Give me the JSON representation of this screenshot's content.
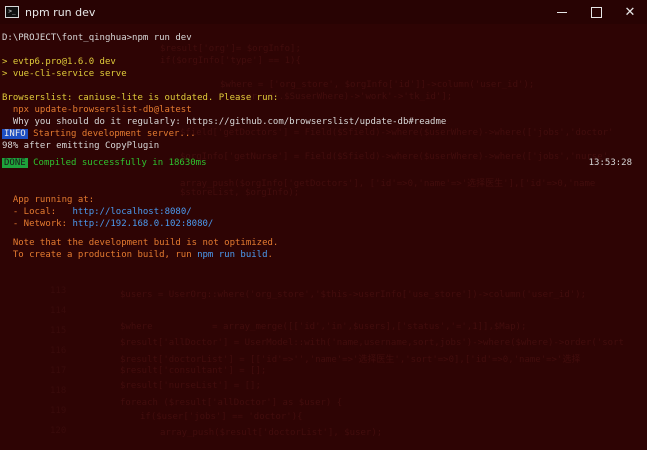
{
  "window": {
    "title": "npm run dev",
    "icon": "terminal-icon"
  },
  "terminal": {
    "prompt": "D:\\PROJECT\\font_qinghua>npm run dev",
    "script_header": "> evtp6.pro@1.6.0 dev",
    "script_command": "> vue-cli-service serve",
    "browserslist_warning": "Browserslist: caniuse-lite is outdated. Please run:",
    "browserslist_cmd": "  npx update-browserslist-db@latest",
    "browserslist_why": "  Why you should do it regularly: https://github.com/browserslist/update-db#readme",
    "info_badge": "INFO",
    "info_text": " Starting development server...",
    "progress": "98% after emitting CopyPlugin",
    "done_badge": "DONE",
    "done_text": " Compiled successfully in 18630ms",
    "done_time": "13:53:28",
    "app_running": "  App running at:",
    "local_label": "  - Local:   ",
    "local_url": "http://localhost:8080/",
    "network_label": "  - Network: ",
    "network_url": "http://192.168.0.102:8080/",
    "note_line1": "  Note that the development build is not optimized.",
    "note_line2_prefix": "  To create a production build, run ",
    "note_line2_cmd": "npm run build",
    "note_line2_suffix": "."
  }
}
